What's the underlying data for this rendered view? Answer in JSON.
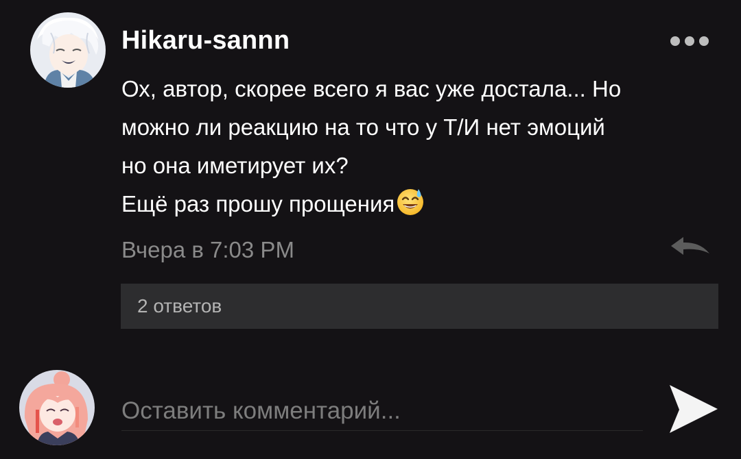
{
  "comment": {
    "author": "Hikaru-sannn",
    "lines": [
      "Ох, автор, скорее всего я вас уже достала... Но",
      "можно ли реакцию на то что у Т/И нет эмоций",
      "но она иметирует их?",
      "Ещё раз прошу прощения"
    ],
    "emoji": "smiling-face-with-sweat-icon",
    "timestamp": "Вчера в 7:03 PM",
    "replies_label": "2 ответов"
  },
  "composer": {
    "placeholder": "Оставить комментарий..."
  },
  "icons": {
    "more": "more-dots-icon",
    "reply": "reply-arrow-icon",
    "send": "send-icon"
  },
  "colors": {
    "background": "#141215",
    "text": "#ffffff",
    "muted": "#8a8a8a",
    "replies_bar": "#2d2d2f"
  }
}
